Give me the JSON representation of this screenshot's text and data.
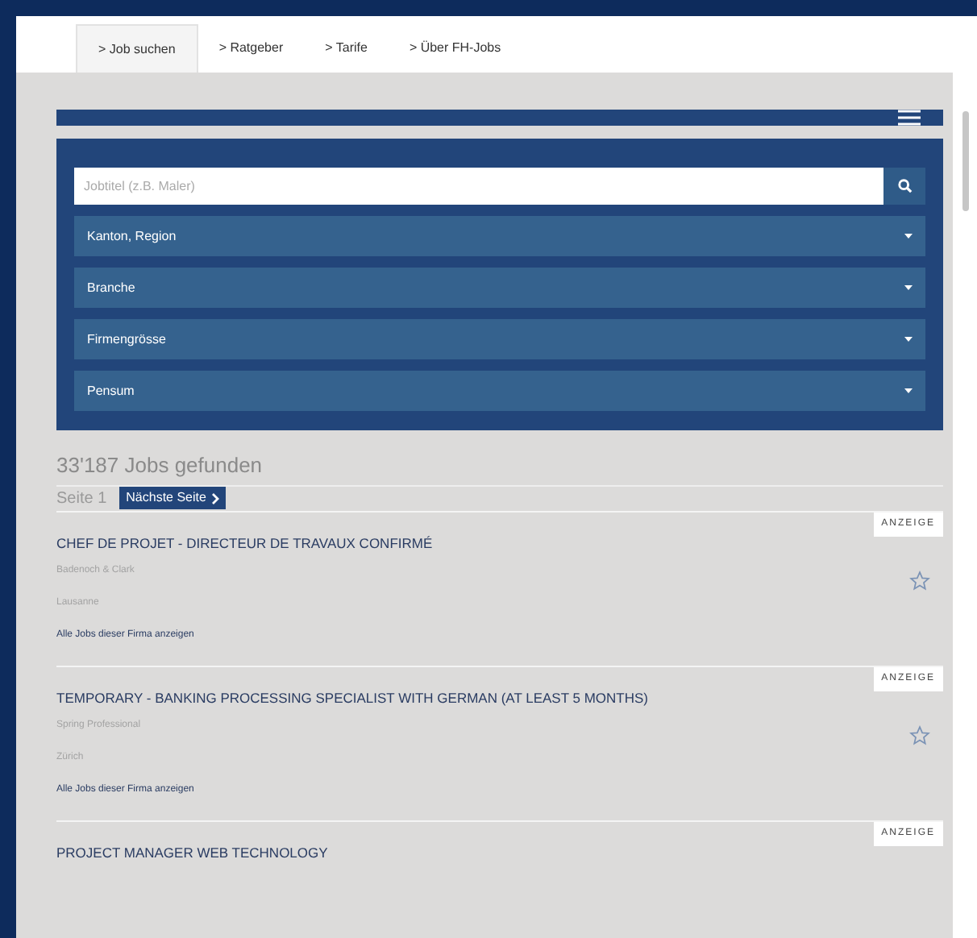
{
  "tabs": [
    {
      "label": "> Job suchen",
      "selected": true
    },
    {
      "label": "> Ratgeber",
      "selected": false
    },
    {
      "label": "> Tarife",
      "selected": false
    },
    {
      "label": "> Über FH-Jobs",
      "selected": false
    }
  ],
  "search": {
    "placeholder": "Jobtitel (z.B. Maler)"
  },
  "filters": [
    "Kanton, Region",
    "Branche",
    "Firmengrösse",
    "Pensum"
  ],
  "results_count": "33'187 Jobs gefunden",
  "pagination": {
    "page": "Seite 1",
    "next": "Nächste Seite"
  },
  "jobs": [
    {
      "badge": "ANZEIGE",
      "title": "CHEF DE PROJET - DIRECTEUR DE TRAVAUX CONFIRMÉ",
      "company": "Badenoch & Clark",
      "location": "Lausanne",
      "link": "Alle Jobs dieser Firma anzeigen",
      "saved": false
    },
    {
      "badge": "ANZEIGE",
      "title": "TEMPORARY - BANKING PROCESSING SPECIALIST WITH GERMAN (AT LEAST 5 MONTHS)",
      "company": "Spring Professional",
      "location": "Zürich",
      "link": "Alle Jobs dieser Firma anzeigen",
      "saved": false
    },
    {
      "badge": "ANZEIGE",
      "title": "PROJECT MANAGER WEB TECHNOLOGY"
    }
  ]
}
